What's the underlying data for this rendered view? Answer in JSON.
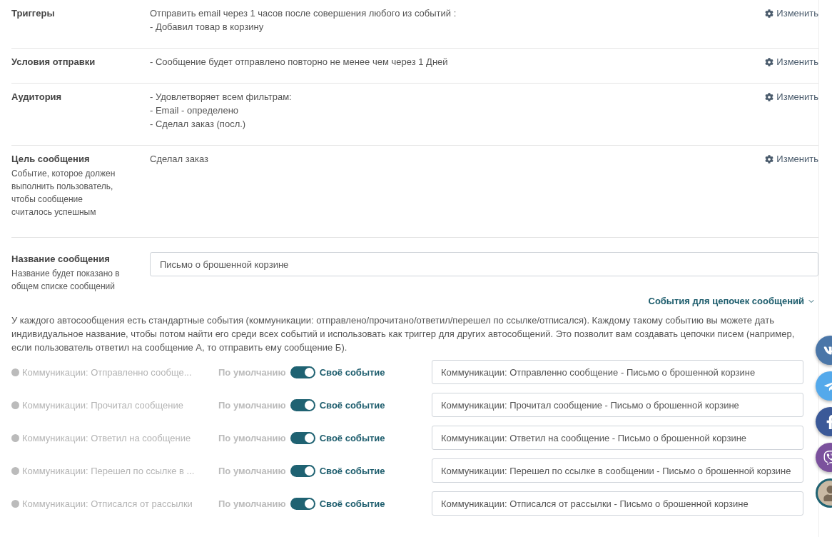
{
  "settings": [
    {
      "label": "Триггеры",
      "lines": [
        "Отправить email через 1 часов после совершения любого из событий :",
        "- Добавил товар в корзину"
      ],
      "edit": "Изменить"
    },
    {
      "label": "Условия отправки",
      "lines": [
        "- Сообщение будет отправлено повторно не менее чем через 1 Дней"
      ],
      "edit": "Изменить"
    },
    {
      "label": "Аудитория",
      "lines": [
        "- Удовлетворяет всем фильтрам:",
        "- Email - определено",
        "- Сделал заказ (посл.)"
      ],
      "edit": "Изменить"
    },
    {
      "label": "Цель сообщения",
      "hint": "Событие, которое должен выполнить пользователь, чтобы сообщение считалось успешным",
      "lines": [
        "Сделал заказ"
      ],
      "edit": "Изменить"
    }
  ],
  "name_field": {
    "label": "Название сообщения",
    "hint": "Название будет показано в общем списке сообщений",
    "value": "Письмо о брошенной корзине"
  },
  "chain_link": "События для цепочек сообщений",
  "description": "У каждого автосообщения есть стандартные события (коммуникации: отправлено/прочитано/ответил/перешел по ссылке/отписался). Каждому такому событию вы можете дать индивидуальное название, чтобы потом найти его среди всех событий и использовать как триггер для других автособщений. Это позволит вам создавать цепочки писем (например, если пользователь ответил на сообщение А, то отправить ему сообщение Б).",
  "events": [
    {
      "name": "Коммуникации: Отправленно сообще...",
      "default_label": "По умолчанию",
      "custom_label": "Своё событие",
      "custom": true,
      "value": "Коммуникации: Отправленно сообщение - Письмо о брошенной корзине"
    },
    {
      "name": "Коммуникации: Прочитал сообщение",
      "default_label": "По умолчанию",
      "custom_label": "Своё событие",
      "custom": true,
      "value": "Коммуникации: Прочитал сообщение - Письмо о брошенной корзине"
    },
    {
      "name": "Коммуникации: Ответил на сообщение",
      "default_label": "По умолчанию",
      "custom_label": "Своё событие",
      "custom": true,
      "value": "Коммуникации: Ответил на сообщение - Письмо о брошенной корзине"
    },
    {
      "name": "Коммуникации: Перешел по ссылке в ...",
      "default_label": "По умолчанию",
      "custom_label": "Своё событие",
      "custom": true,
      "value": "Коммуникации: Перешел по ссылке в сообщении - Письмо о брошенной корзине"
    },
    {
      "name": "Коммуникации: Отписался от рассылки",
      "default_label": "По умолчанию",
      "custom_label": "Своё событие",
      "custom": true,
      "value": "Коммуникации: Отписался от рассылки - Письмо о брошенной корзине"
    }
  ],
  "contact_buttons": [
    {
      "kind": "vk"
    },
    {
      "kind": "telegram"
    },
    {
      "kind": "facebook"
    },
    {
      "kind": "viber"
    },
    {
      "kind": "avatar"
    }
  ]
}
